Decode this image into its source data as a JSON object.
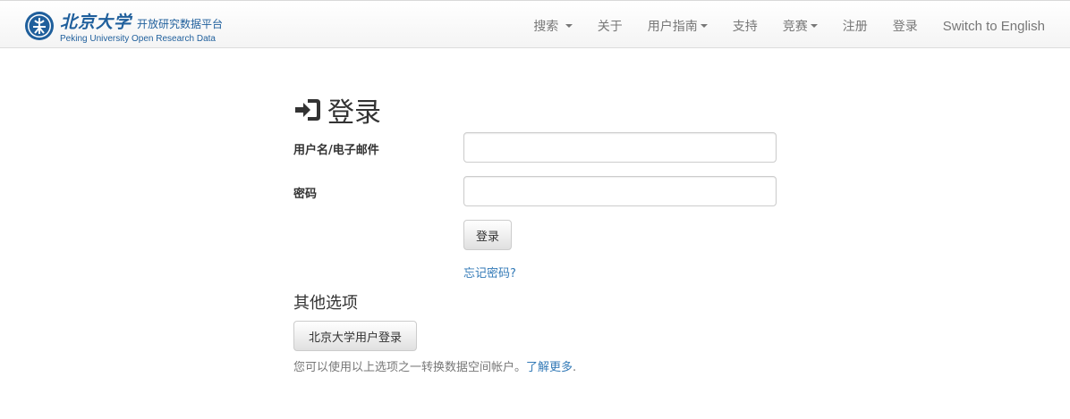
{
  "brand": {
    "logo_cn": "北京大学",
    "subtitle_cn": "开放研究数据平台",
    "subtitle_en": "Peking University Open Research Data",
    "seal_icon": "pku-seal-icon"
  },
  "nav": {
    "items": [
      {
        "label": "搜索",
        "dropdown": true
      },
      {
        "label": "关于",
        "dropdown": false
      },
      {
        "label": "用户指南",
        "dropdown": true
      },
      {
        "label": "支持",
        "dropdown": false
      },
      {
        "label": "竞赛",
        "dropdown": true
      },
      {
        "label": "注册",
        "dropdown": false
      },
      {
        "label": "登录",
        "dropdown": false
      },
      {
        "label": "Switch to English",
        "dropdown": false
      }
    ]
  },
  "login": {
    "title": "登录",
    "icon": "sign-in-icon",
    "username_label": "用户名/电子邮件",
    "username_value": "",
    "password_label": "密码",
    "password_value": "",
    "submit_label": "登录",
    "forgot_label": "忘记密码?"
  },
  "other": {
    "title": "其他选项",
    "pku_button_label": "北京大学用户登录",
    "help_text": "您可以使用以上选项之一转换数据空间帐户。",
    "learn_more": "了解更多",
    "learn_more_suffix": "."
  },
  "colors": {
    "brand": "#1f5f9c",
    "link": "#337ab7",
    "nav_text": "#777777"
  }
}
